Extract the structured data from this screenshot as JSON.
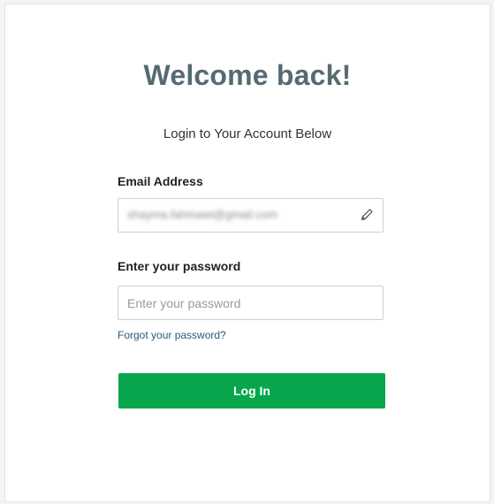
{
  "page": {
    "title": "Welcome back!",
    "subtitle": "Login to Your Account Below"
  },
  "email": {
    "label": "Email Address",
    "value": "shayma.fahmawi@gmail.com",
    "value_obscured": true,
    "icon": "pencil-icon"
  },
  "password": {
    "label": "Enter your password",
    "placeholder": "Enter your password",
    "value": ""
  },
  "forgot_link": "Forgot your password?",
  "login_button": {
    "label": "Log In",
    "color": "#08a64c"
  },
  "colors": {
    "title": "#566a72",
    "link": "#2b5c7a",
    "card_border": "#e3e3e3"
  }
}
